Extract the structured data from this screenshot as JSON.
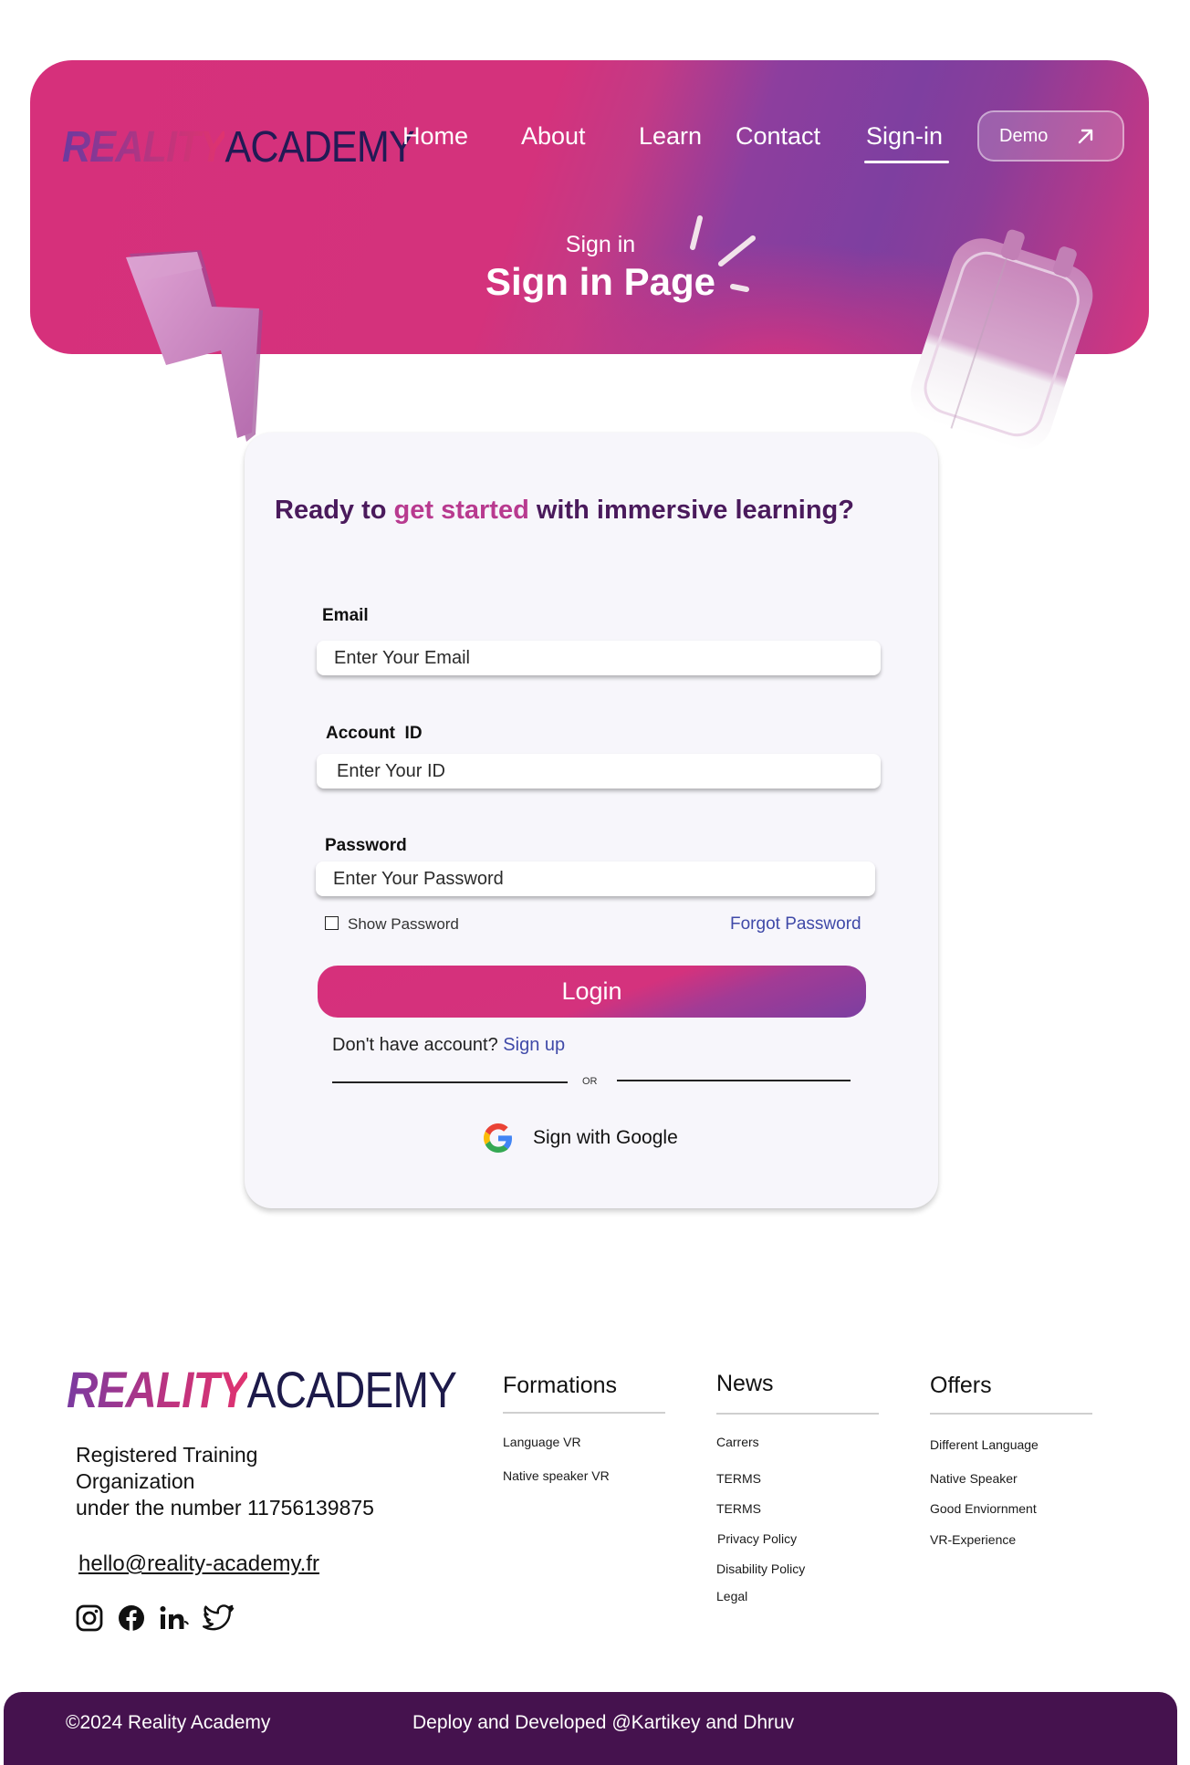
{
  "brand": {
    "part1": "REALITY",
    "part2": "ACADEMY"
  },
  "nav": {
    "home": "Home",
    "about": "About",
    "learn": "Learn",
    "contact": "Contact",
    "signin": "Sign-in",
    "demo": "Demo"
  },
  "hero": {
    "subtitle": "Sign in",
    "title": "Sign in Page"
  },
  "card": {
    "heading_1": "Ready to",
    "heading_accent": "get started",
    "heading_2": "with immersive learning?",
    "email_label": "Email",
    "email_placeholder": "Enter Your Email",
    "account_label": "Account  ID",
    "account_placeholder": "Enter Your ID",
    "password_label": "Password",
    "password_placeholder": "Enter Your Password",
    "show_password": "Show Password",
    "forgot": "Forgot Password",
    "login": "Login",
    "no_account": "Don't have account?",
    "signup": "Sign up",
    "or": "OR",
    "google": "Sign with Google"
  },
  "footer": {
    "org_line1": "Registered Training",
    "org_line2": "Organization",
    "org_line3": "under the number 11756139875",
    "email": "hello@reality-academy.fr",
    "columns": [
      {
        "title": "Formations",
        "items": [
          "Language VR",
          "Native speaker VR"
        ]
      },
      {
        "title": "News",
        "items": [
          "Carrers",
          "TERMS",
          "TERMS",
          "Privacy Policy",
          "Disability Policy",
          "Legal"
        ]
      },
      {
        "title": "Offers",
        "items": [
          "Different Language",
          "Native Speaker",
          "Good Enviornment",
          "VR-Experience"
        ]
      }
    ],
    "copyright": "©2024 Reality Academy",
    "credit": "Deploy and Developed @Kartikey and Dhruv"
  },
  "icons": {
    "demo_arrow": "arrow-up-right-icon",
    "google": "google-icon",
    "socials": [
      "instagram-icon",
      "facebook-icon",
      "linkedin-icon",
      "twitter-icon"
    ]
  },
  "colors": {
    "brand_pink": "#d6307b",
    "brand_purple": "#7e3fa0",
    "heading_purple": "#4a1a5c",
    "accent_pink": "#b83a8f",
    "link_blue": "#3f49a8",
    "footer_bar": "#45124e"
  }
}
